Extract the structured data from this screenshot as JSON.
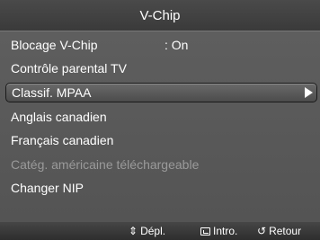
{
  "title": "V-Chip",
  "menu": {
    "items": [
      {
        "label": "Blocage V-Chip",
        "value": ": On"
      },
      {
        "label": "Contrôle parental TV"
      },
      {
        "label": "Classif. MPAA"
      },
      {
        "label": "Anglais canadien"
      },
      {
        "label": "Français canadien"
      },
      {
        "label": "Catég. américaine téléchargeable"
      },
      {
        "label": "Changer NIP"
      }
    ],
    "selected_index": 2,
    "disabled_index": 5
  },
  "footer": {
    "move_label": "Dépl.",
    "enter_label": "Intro.",
    "return_label": "Retour",
    "move_icon": "up-down-arrows-icon",
    "enter_icon": "enter-icon",
    "return_icon": "return-icon"
  },
  "colors": {
    "panel": "#5a5a5a",
    "text": "#ffffff",
    "disabled_text": "#9a9a9a"
  }
}
